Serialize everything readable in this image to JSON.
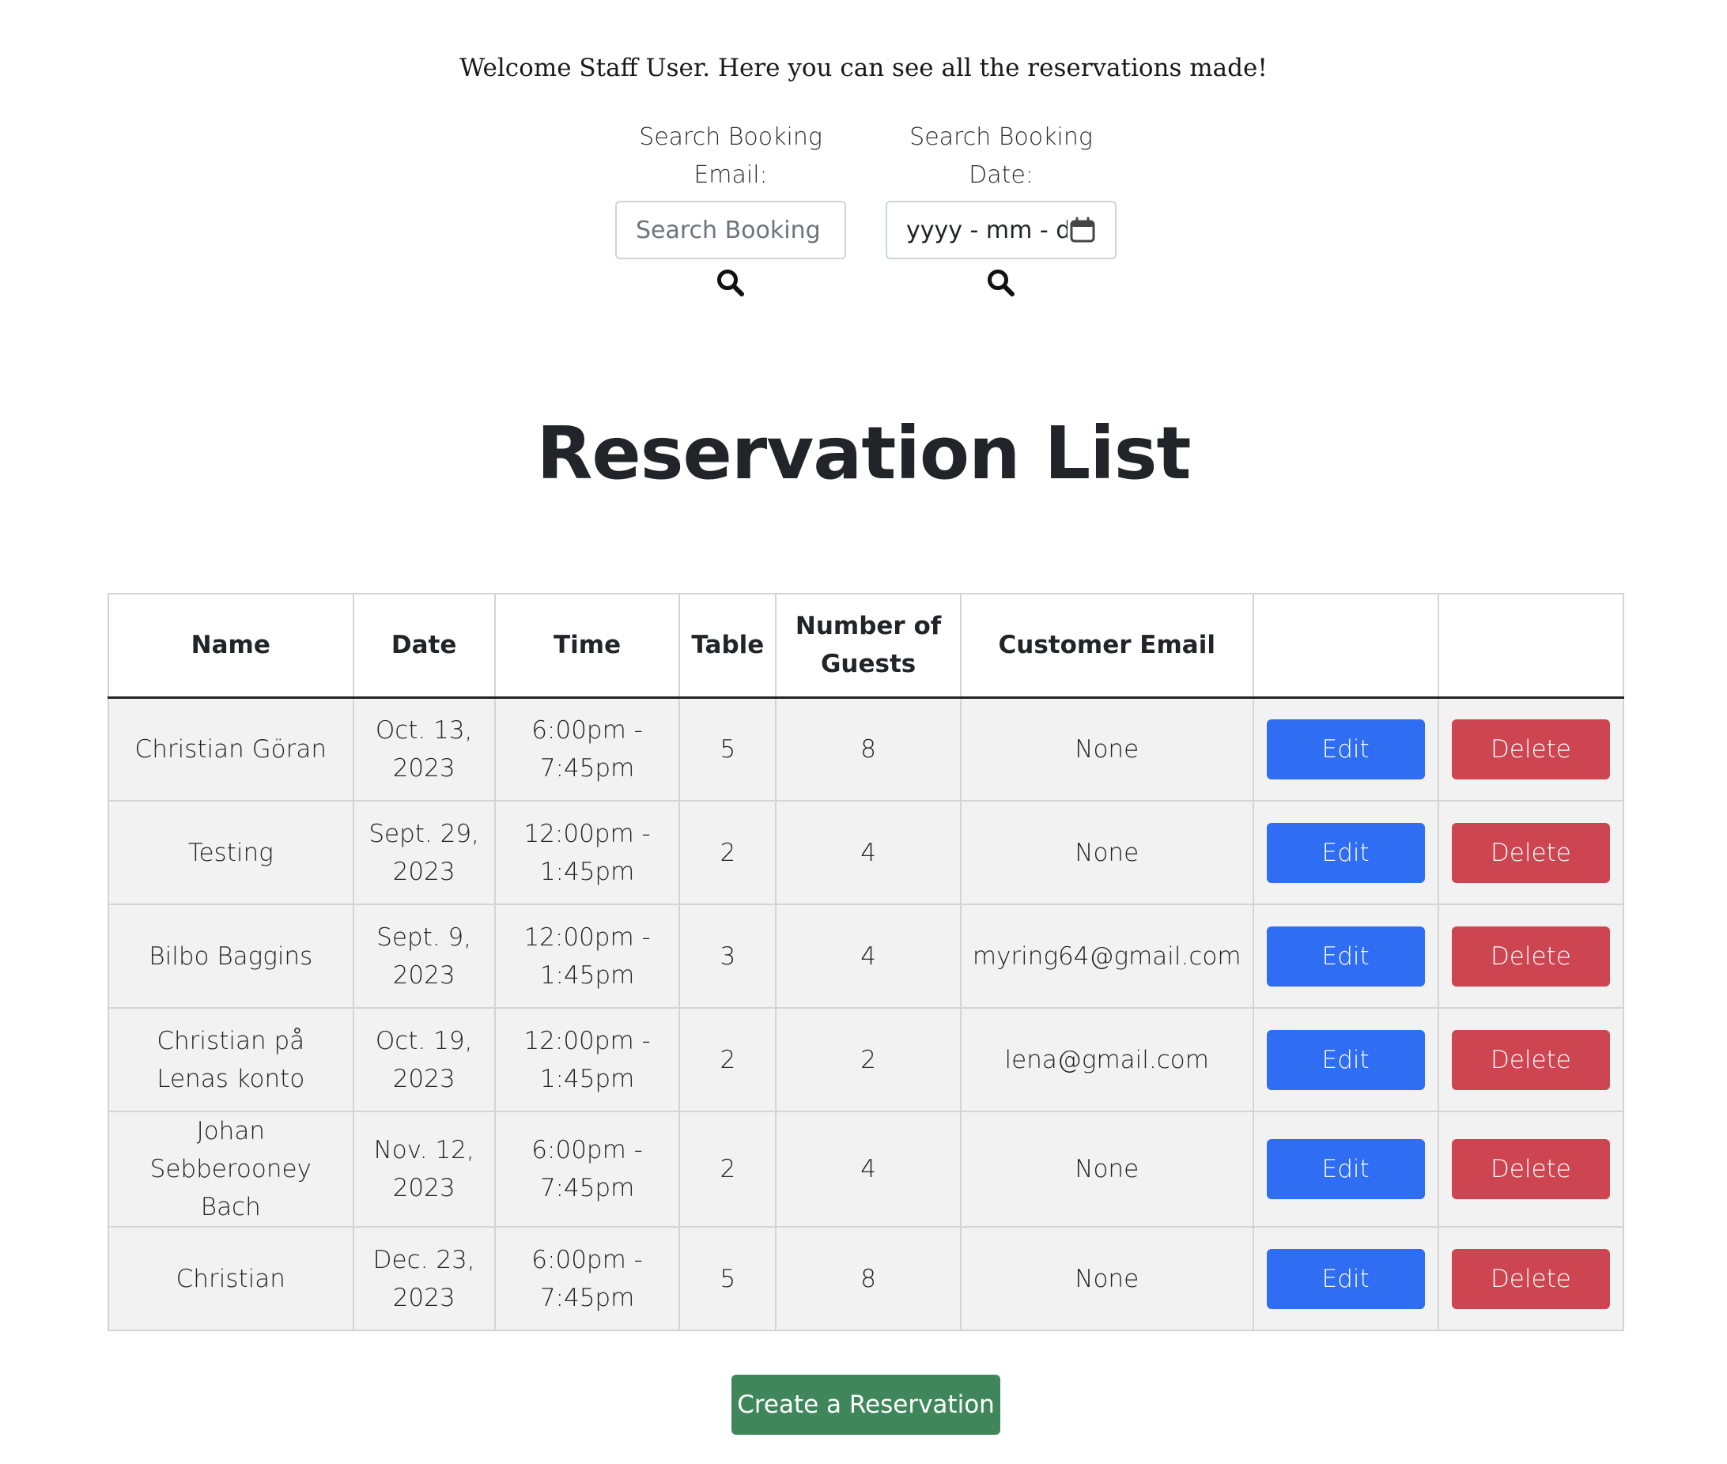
{
  "header": {
    "welcome_text": "Welcome Staff User. Here you can see all the reservations made!"
  },
  "search": {
    "email": {
      "label_line1": "Search Booking",
      "label_line2": "Email:",
      "placeholder": "Search Booking Email"
    },
    "date": {
      "label_line1": "Search Booking",
      "label_line2": "Date:",
      "value_text": "yyyy - mm - dd"
    },
    "icons": {
      "search": "search-icon",
      "calendar": "calendar-icon"
    }
  },
  "page_title": "Reservation List",
  "table": {
    "headers": {
      "name": "Name",
      "date": "Date",
      "time": "Time",
      "table": "Table",
      "guests_line1": "Number of",
      "guests_line2": "Guests",
      "email": "Customer Email"
    },
    "edit_label": "Edit",
    "delete_label": "Delete",
    "rows": [
      {
        "name": "Christian Göran",
        "date": "Oct. 13, 2023",
        "time": "6:00pm - 7:45pm",
        "table": "5",
        "guests": "8",
        "email": "None"
      },
      {
        "name": "Testing",
        "date": "Sept. 29, 2023",
        "time": "12:00pm - 1:45pm",
        "table": "2",
        "guests": "4",
        "email": "None"
      },
      {
        "name": "Bilbo Baggins",
        "date": "Sept. 9, 2023",
        "time": "12:00pm - 1:45pm",
        "table": "3",
        "guests": "4",
        "email": "myring64@gmail.com"
      },
      {
        "name": "Christian på Lenas konto",
        "date": "Oct. 19, 2023",
        "time": "12:00pm - 1:45pm",
        "table": "2",
        "guests": "2",
        "email": "lena@gmail.com"
      },
      {
        "name": "Johan Sebberooney Bach",
        "date": "Nov. 12, 2023",
        "time": "6:00pm - 7:45pm",
        "table": "2",
        "guests": "4",
        "email": "None"
      },
      {
        "name": "Christian",
        "date": "Dec. 23, 2023",
        "time": "6:00pm - 7:45pm",
        "table": "5",
        "guests": "8",
        "email": "None"
      }
    ]
  },
  "create_button_label": "Create a Reservation",
  "colors": {
    "edit": "#2f6ef2",
    "delete": "#cc4550",
    "create": "#3f875b"
  }
}
